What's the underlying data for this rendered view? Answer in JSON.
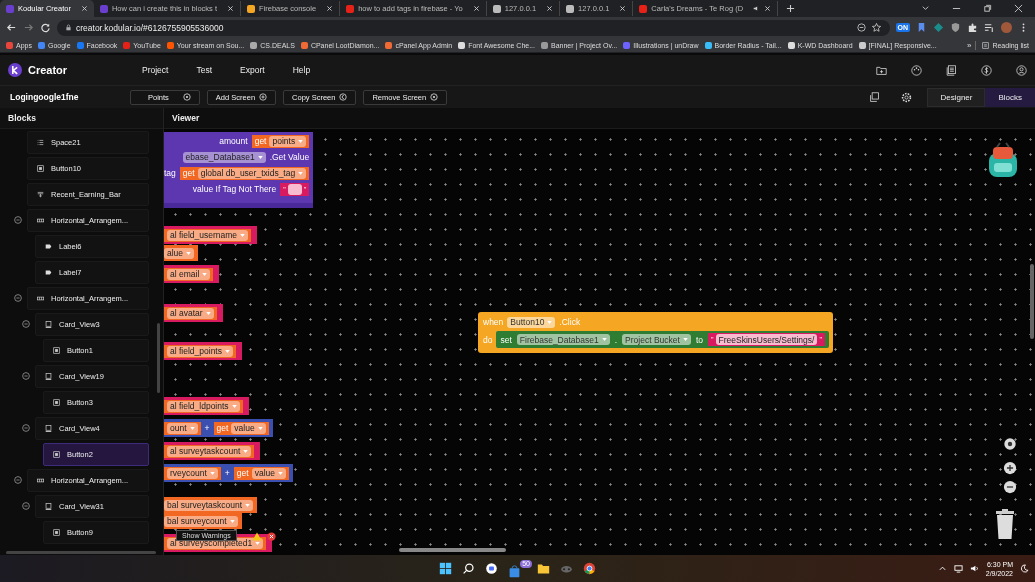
{
  "browser": {
    "tabs": [
      {
        "title": "Kodular Creator",
        "selected": true,
        "audio": false
      },
      {
        "title": "How can i create this in blocks t",
        "selected": false,
        "audio": false
      },
      {
        "title": "Firebase console",
        "selected": false,
        "audio": false
      },
      {
        "title": "how to add tags in firebase - Yo",
        "selected": false,
        "audio": false
      },
      {
        "title": "127.0.0.1",
        "selected": false,
        "audio": false
      },
      {
        "title": "127.0.0.1",
        "selected": false,
        "audio": false
      },
      {
        "title": "Carla's Dreams - Te Rog (D",
        "selected": false,
        "audio": true
      }
    ],
    "address": "creator.kodular.io/#6126755905536000",
    "extension_badge": "ON",
    "bookmarks": [
      "Apps",
      "Google",
      "Facebook",
      "YouTube",
      "Your stream on Sou...",
      "CS.DEALS",
      "CPanel LootDiamon...",
      "cPanel App Admin",
      "Font Awesome Che...",
      "Banner | Project Ov...",
      "Illustrations | unDraw",
      "Border Radius - Tail...",
      "K-WD Dashboard",
      "[FINAL] Responsive..."
    ],
    "more": "»",
    "reading_list": "Reading list"
  },
  "app": {
    "brand": "Creator",
    "menu": [
      "Project",
      "Test",
      "Export",
      "Help"
    ],
    "project": "Logingoogle1fne",
    "actions": [
      "Points",
      "Add Screen",
      "Copy Screen",
      "Remove Screen"
    ],
    "views": [
      {
        "label": "Designer",
        "selected": false
      },
      {
        "label": "Blocks",
        "selected": true
      }
    ]
  },
  "sidebar": {
    "title": "Blocks",
    "items": [
      {
        "label": "Space21",
        "kind": "space",
        "selected": false
      },
      {
        "label": "Button10",
        "kind": "button",
        "selected": false
      },
      {
        "label": "Recent_Earning_Bar",
        "kind": "progress",
        "selected": false
      },
      {
        "label": "Horizontal_Arrangem...",
        "kind": "arrangement",
        "selected": false,
        "expanded": true,
        "children": [
          {
            "label": "Label6",
            "kind": "label",
            "selected": false
          },
          {
            "label": "Label7",
            "kind": "label",
            "selected": false
          }
        ]
      },
      {
        "label": "Horizontal_Arrangem...",
        "kind": "arrangement",
        "selected": false,
        "expanded": true,
        "children": [
          {
            "label": "Card_View3",
            "kind": "card",
            "selected": false,
            "expanded": true,
            "children": [
              {
                "label": "Button1",
                "kind": "button",
                "selected": false
              }
            ]
          },
          {
            "label": "Card_View19",
            "kind": "card",
            "selected": false,
            "expanded": true,
            "children": [
              {
                "label": "Button3",
                "kind": "button",
                "selected": false
              }
            ]
          },
          {
            "label": "Card_View4",
            "kind": "card",
            "selected": false,
            "expanded": true,
            "children": [
              {
                "label": "Button2",
                "kind": "button",
                "selected": true
              }
            ]
          }
        ]
      },
      {
        "label": "Horizontal_Arrangem...",
        "kind": "arrangement",
        "selected": false,
        "expanded": true,
        "children": [
          {
            "label": "Card_View31",
            "kind": "card",
            "selected": false,
            "expanded": true,
            "children": [
              {
                "label": "Button9",
                "kind": "button",
                "selected": false
              }
            ]
          }
        ]
      }
    ]
  },
  "viewer": {
    "title": "Viewer",
    "tooltip": "Show Warnings",
    "blocks": [
      {
        "kind": "procedure",
        "rows": [
          [
            {
              "kind": "label",
              "text": "amount"
            },
            {
              "kind": "get",
              "label": "get",
              "value": "points"
            }
          ],
          [
            {
              "kind": "dropdown",
              "text": "ebase_Database1"
            },
            {
              "kind": "label",
              "text": ".Get Value"
            }
          ],
          [
            {
              "kind": "label",
              "text": "tag"
            },
            {
              "kind": "get",
              "label": "get",
              "value": "global db_user_txids_tag"
            }
          ],
          [
            {
              "kind": "label",
              "text": "value If Tag Not There"
            },
            {
              "kind": "text",
              "open": "\"",
              "close": "\""
            }
          ]
        ]
      },
      {
        "kind": "string",
        "rows": [
          [
            {
              "kind": "get",
              "value": "al field_username"
            }
          ]
        ]
      },
      {
        "kind": "variable",
        "rows": [
          [
            {
              "kind": "dropdown",
              "text": "alue"
            }
          ]
        ]
      },
      {
        "kind": "string",
        "rows": [
          [
            {
              "kind": "get",
              "value": "al email"
            }
          ]
        ]
      },
      {
        "kind": "string",
        "rows": [
          [
            {
              "kind": "get",
              "value": "al avatar"
            }
          ]
        ]
      },
      {
        "kind": "string",
        "rows": [
          [
            {
              "kind": "get",
              "value": "al field_points"
            }
          ]
        ]
      },
      {
        "kind": "string",
        "rows": [
          [
            {
              "kind": "get",
              "value": "al field_ldpoints"
            }
          ]
        ]
      },
      {
        "kind": "math",
        "rows": [
          [
            {
              "kind": "get",
              "value": "ount"
            },
            {
              "kind": "label",
              "text": "+"
            },
            {
              "kind": "get",
              "label": "get",
              "value": "value"
            }
          ]
        ]
      },
      {
        "kind": "string",
        "rows": [
          [
            {
              "kind": "get",
              "value": "al surveytaskcount"
            }
          ]
        ]
      },
      {
        "kind": "math",
        "rows": [
          [
            {
              "kind": "get",
              "value": "rveycount"
            },
            {
              "kind": "label",
              "text": "+"
            },
            {
              "kind": "get",
              "label": "get",
              "value": "value"
            }
          ]
        ]
      },
      {
        "kind": "variable",
        "rows": [
          [
            {
              "kind": "dropdown",
              "text": "bal surveytaskcount"
            }
          ]
        ]
      },
      {
        "kind": "variable",
        "rows": [
          [
            {
              "kind": "dropdown",
              "text": "bal surveycount"
            }
          ]
        ]
      },
      {
        "kind": "string",
        "rows": [
          [
            {
              "kind": "get",
              "value": "al surveyscompleted1"
            }
          ]
        ]
      },
      {
        "kind": "event",
        "rows": [
          [
            {
              "kind": "label",
              "text": "when"
            },
            {
              "kind": "dropdown",
              "text": "Button10"
            },
            {
              "kind": "label",
              "text": ".Click"
            }
          ],
          [
            {
              "kind": "label",
              "text": "do"
            },
            {
              "kind": "setter",
              "parts": [
                {
                  "kind": "label",
                  "text": "set"
                },
                {
                  "kind": "dropdown",
                  "text": "Firebase_Database1"
                },
                {
                  "kind": "label",
                  "text": "."
                },
                {
                  "kind": "dropdown",
                  "text": "Project Bucket"
                },
                {
                  "kind": "label",
                  "text": "to"
                },
                {
                  "kind": "text",
                  "open": "\"",
                  "value": "FreeSkinsUsers/Settings/",
                  "close": "\""
                }
              ]
            }
          ]
        ]
      }
    ]
  },
  "taskbar": {
    "badge": "50",
    "time": "6:30 PM",
    "date": "2/9/2022"
  }
}
